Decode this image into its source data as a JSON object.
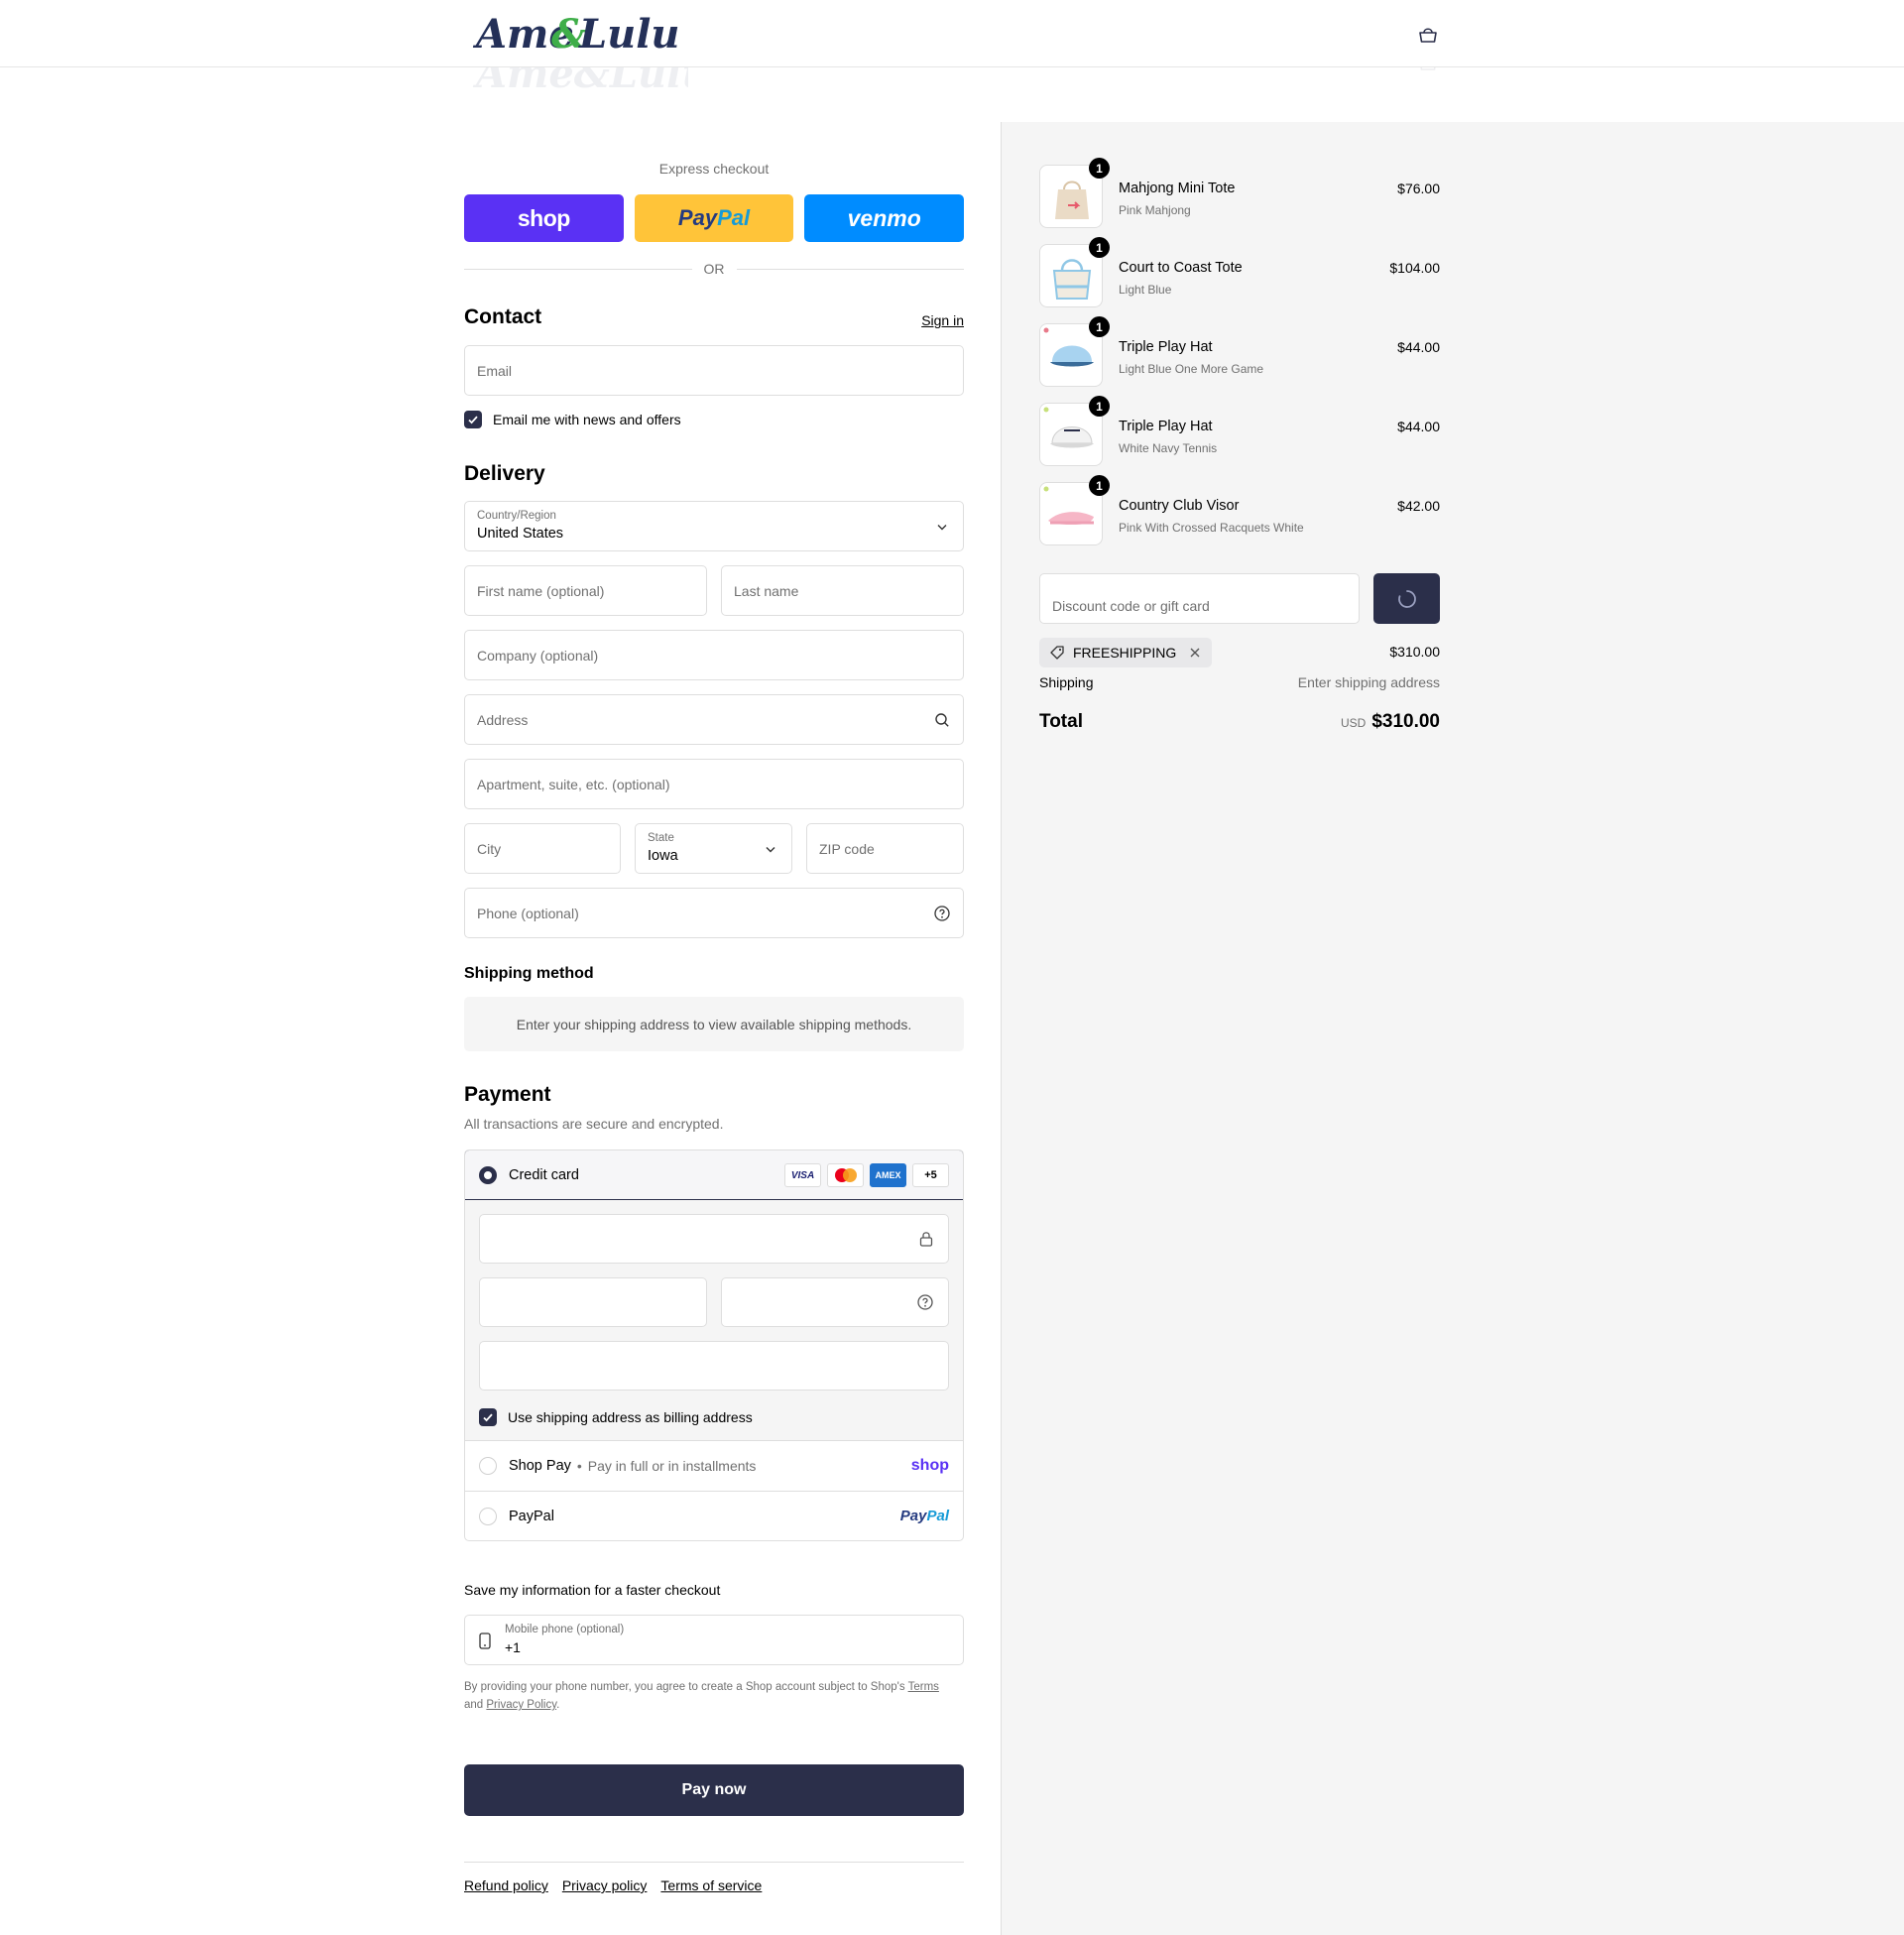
{
  "header": {
    "brand": "Ame & Lulu",
    "cart_icon": "bag-icon"
  },
  "express": {
    "title": "Express checkout",
    "shop_label": "shop",
    "paypal_label_1": "Pay",
    "paypal_label_2": "Pal",
    "venmo_label": "venmo",
    "or_label": "OR"
  },
  "contact": {
    "title": "Contact",
    "sign_in": "Sign in",
    "email_placeholder": "Email",
    "news_label": "Email me with news and offers",
    "news_checked": true
  },
  "delivery": {
    "title": "Delivery",
    "country_label": "Country/Region",
    "country_value": "United States",
    "first_name_placeholder": "First name (optional)",
    "last_name_placeholder": "Last name",
    "company_placeholder": "Company (optional)",
    "address_placeholder": "Address",
    "apartment_placeholder": "Apartment, suite, etc. (optional)",
    "city_placeholder": "City",
    "state_label": "State",
    "state_value": "Iowa",
    "zip_placeholder": "ZIP code",
    "phone_placeholder": "Phone (optional)"
  },
  "shipping_method": {
    "title": "Shipping method",
    "note": "Enter your shipping address to view available shipping methods."
  },
  "payment": {
    "title": "Payment",
    "subtitle": "All transactions are secure and encrypted.",
    "credit_card_label": "Credit card",
    "card_logos": [
      "VISA",
      "mastercard",
      "AMEX",
      "+5"
    ],
    "billing_label": "Use shipping address as billing address",
    "shop_pay_label": "Shop Pay",
    "shop_pay_sub": "Pay in full or in installments",
    "shop_pay_brand": "shop",
    "paypal_label": "PayPal",
    "paypal_brand_1": "Pay",
    "paypal_brand_2": "Pal"
  },
  "save_info": {
    "title": "Save my information for a faster checkout",
    "mobile_label": "Mobile phone (optional)",
    "mobile_value": "+1",
    "legal_1": "By providing your phone number, you agree to create a Shop account subject to Shop's ",
    "terms": "Terms",
    "legal_2": "and ",
    "privacy": "Privacy Policy",
    "legal_3": "."
  },
  "pay_now": "Pay now",
  "footer": {
    "links": [
      "Refund policy",
      "Privacy policy",
      "Terms of service"
    ]
  },
  "summary": {
    "items": [
      {
        "name": "Mahjong Mini Tote",
        "variant": "Pink Mahjong",
        "price": "$76.00",
        "qty": "1"
      },
      {
        "name": "Court to Coast Tote",
        "variant": "Light Blue",
        "price": "$104.00",
        "qty": "1"
      },
      {
        "name": "Triple Play Hat",
        "variant": "Light Blue One More Game",
        "price": "$44.00",
        "qty": "1"
      },
      {
        "name": "Triple Play Hat",
        "variant": "White Navy Tennis",
        "price": "$44.00",
        "qty": "1"
      },
      {
        "name": "Country Club Visor",
        "variant": "Pink With Crossed Racquets White",
        "price": "$42.00",
        "qty": "1"
      }
    ],
    "discount_placeholder": "Discount code or gift card",
    "applied_code": "FREESHIPPING",
    "subtotal": "$310.00",
    "shipping_label": "Shipping",
    "shipping_value": "Enter shipping address",
    "total_label": "Total",
    "currency": "USD",
    "total_value": "$310.00"
  },
  "colors": {
    "primary": "#2b2f4a",
    "shop": "#5a31f4",
    "paypal": "#ffc439",
    "venmo": "#008cff",
    "sidebar_bg": "#f5f5f5"
  }
}
